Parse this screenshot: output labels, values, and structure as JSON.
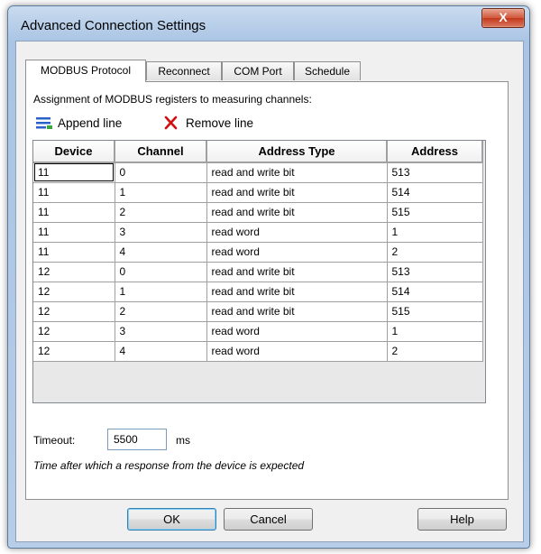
{
  "window": {
    "title": "Advanced Connection Settings",
    "close_glyph": "X"
  },
  "tabs": [
    {
      "label": "MODBUS Protocol",
      "active": true
    },
    {
      "label": "Reconnect",
      "active": false
    },
    {
      "label": "COM Port",
      "active": false
    },
    {
      "label": "Schedule",
      "active": false
    }
  ],
  "panel": {
    "description": "Assignment of MODBUS registers to measuring channels:",
    "append_label": "Append line",
    "remove_label": "Remove line"
  },
  "table": {
    "columns": [
      "Device",
      "Channel",
      "Address Type",
      "Address"
    ],
    "rows": [
      [
        "11",
        "0",
        "read and write bit",
        "513"
      ],
      [
        "11",
        "1",
        "read and write bit",
        "514"
      ],
      [
        "11",
        "2",
        "read and write bit",
        "515"
      ],
      [
        "11",
        "3",
        "read word",
        "1"
      ],
      [
        "11",
        "4",
        "read word",
        "2"
      ],
      [
        "12",
        "0",
        "read and write bit",
        "513"
      ],
      [
        "12",
        "1",
        "read and write bit",
        "514"
      ],
      [
        "12",
        "2",
        "read and write bit",
        "515"
      ],
      [
        "12",
        "3",
        "read word",
        "1"
      ],
      [
        "12",
        "4",
        "read word",
        "2"
      ]
    ]
  },
  "timeout": {
    "label": "Timeout:",
    "value": "5500",
    "unit": "ms",
    "hint": "Time after which a response from the device is expected"
  },
  "buttons": {
    "ok": "OK",
    "cancel": "Cancel",
    "help": "Help"
  },
  "colors": {
    "append_icon": "#2a62c9",
    "remove_icon": "#d01010"
  }
}
